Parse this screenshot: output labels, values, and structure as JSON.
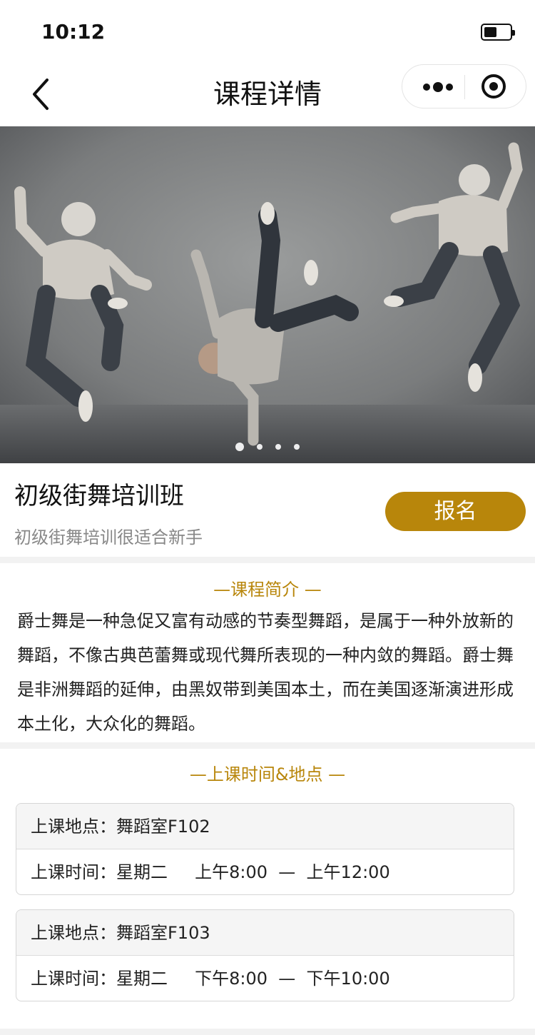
{
  "status_bar": {
    "time": "10:12"
  },
  "nav": {
    "title": "课程详情"
  },
  "banner": {
    "slide_count": 4,
    "active_index": 0
  },
  "course": {
    "title": "初级街舞培训班",
    "subtitle": "初级街舞培训很适合新手",
    "signup_label": "报名"
  },
  "intro": {
    "heading": "—课程简介 —",
    "text": "爵士舞是一种急促又富有动感的节奏型舞蹈，是属于一种外放新的舞蹈，不像古典芭蕾舞或现代舞所表现的一种内敛的舞蹈。爵士舞是非洲舞蹈的延伸，由黑奴带到美国本土，而在美国逐渐演进形成本土化，大众化的舞蹈。"
  },
  "schedule": {
    "heading": "—上课时间&地点 —",
    "items": [
      {
        "location": "上课地点：舞蹈室F102",
        "time": "上课时间：星期二     上午8:00  —  上午12:00"
      },
      {
        "location": "上课地点：舞蹈室F103",
        "time": "上课时间：星期二     下午8:00  —  下午10:00"
      }
    ]
  },
  "colors": {
    "accent": "#b8860b",
    "text": "#222222",
    "subtle": "#888888",
    "separator": "#f2f2f2"
  }
}
